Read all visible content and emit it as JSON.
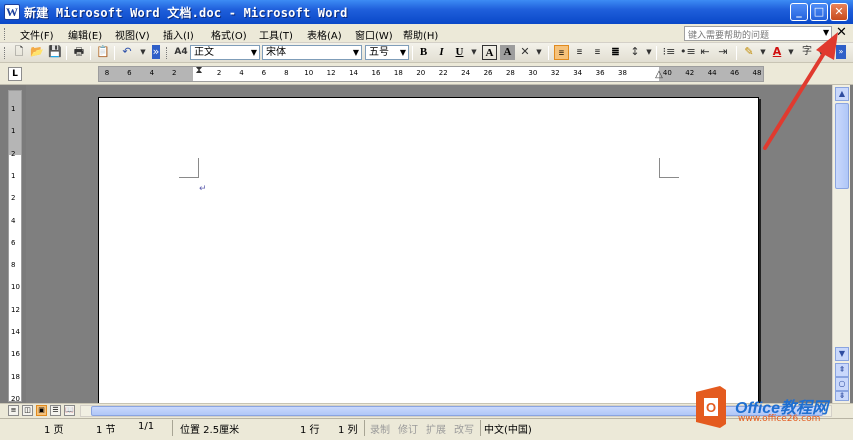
{
  "titlebar": {
    "app_icon": "W",
    "title": "新建 Microsoft Word 文档.doc - Microsoft Word"
  },
  "window_buttons": {
    "minimize": "_",
    "maximize": "□",
    "close": "✕"
  },
  "menu": [
    {
      "label": "文件(F)"
    },
    {
      "label": "编辑(E)"
    },
    {
      "label": "视图(V)"
    },
    {
      "label": "插入(I)"
    },
    {
      "label": "格式(O)"
    },
    {
      "label": "工具(T)"
    },
    {
      "label": "表格(A)"
    },
    {
      "label": "窗口(W)"
    },
    {
      "label": "帮助(H)"
    }
  ],
  "help_search": {
    "placeholder": "键入需要帮助的问题"
  },
  "toolbar": {
    "style_value": "正文",
    "font_value": "宋体",
    "size_value": "五号",
    "style_icon": "A4"
  },
  "ruler": {
    "tab_selector": "L",
    "h_ticks": [
      "8",
      "6",
      "4",
      "2",
      "",
      "2",
      "4",
      "6",
      "8",
      "10",
      "12",
      "14",
      "16",
      "18",
      "20",
      "22",
      "24",
      "26",
      "28",
      "30",
      "32",
      "34",
      "36",
      "38",
      "",
      "40",
      "42",
      "44",
      "46",
      "48"
    ],
    "v_ticks": [
      "1",
      "1",
      "2",
      "1",
      "2",
      "4",
      "6",
      "8",
      "10",
      "12",
      "14",
      "16",
      "18",
      "20"
    ]
  },
  "document": {
    "paragraph_mark": "↵"
  },
  "status": {
    "page": "1 页",
    "section": "1 节",
    "page_of": "1/1",
    "position": "位置 2.5厘米",
    "line": "1 行",
    "column": "1 列",
    "rec": "录制",
    "trk": "修订",
    "ext": "扩展",
    "ovr": "改写",
    "language": "中文(中国)"
  },
  "watermark": {
    "logo_letter": "O",
    "brand": "Office教程网",
    "url": "www.office26.com"
  },
  "colors": {
    "title_blue": "#0a48c8",
    "ui_face": "#ece9d8",
    "arrow_red": "#e03a2f",
    "active_orange": "#f6c27a"
  }
}
